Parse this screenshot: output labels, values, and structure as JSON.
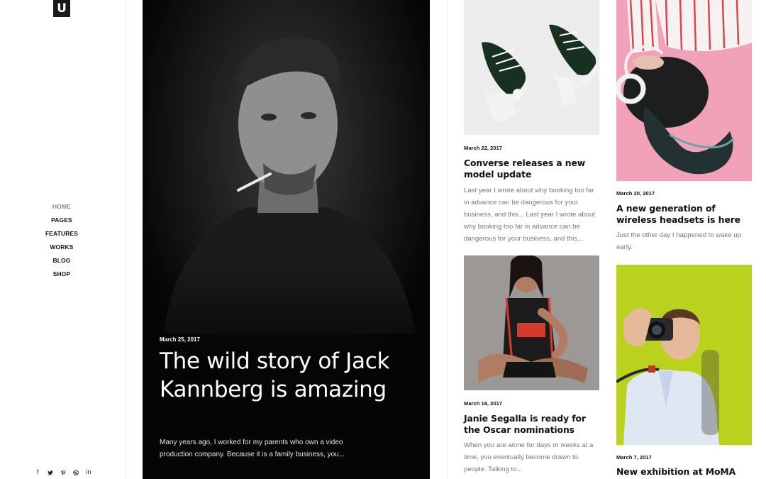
{
  "logo": {
    "letter": "U"
  },
  "nav": [
    "HOME",
    "PAGES",
    "FEATURES",
    "WORKS",
    "BLOG",
    "SHOP"
  ],
  "social": {
    "icons": [
      "facebook-icon",
      "twitter-icon",
      "pinterest-icon",
      "dribbble-icon",
      "linkedin-icon"
    ],
    "labels": [
      "f",
      "in"
    ]
  },
  "hero": {
    "date": "March 25, 2017",
    "title": "The wild story of Jack Kannberg is amazing",
    "excerpt": "Many years ago, I worked for my parents who own a video production company. Because it is a family business, you..."
  },
  "posts": [
    {
      "date": "March 22, 2017",
      "title": "Converse releases a new model update",
      "excerpt": "Last year I wrote about why booking too far in advance can be dangerous for your business, and this... Last year I wrote about why booking too far in advance can be dangerous for your business, and this..."
    },
    {
      "date": "March 20, 2017",
      "title": "A new generation of wireless headsets is here",
      "excerpt": "Just the other day I happened to wake up early."
    },
    {
      "date": "March 18, 2017",
      "title": "Janie Segalla is ready for the Oscar nominations",
      "excerpt": "When you are alone for days or weeks at a time, you eventually become drawn to people. Talking to..."
    },
    {
      "date": "March 7, 2017",
      "title": "New exhibition at MoMA"
    }
  ],
  "colors": {
    "accent_pink": "#f4a9bd",
    "accent_lime": "#b9d21f",
    "text_grey": "#777777"
  }
}
